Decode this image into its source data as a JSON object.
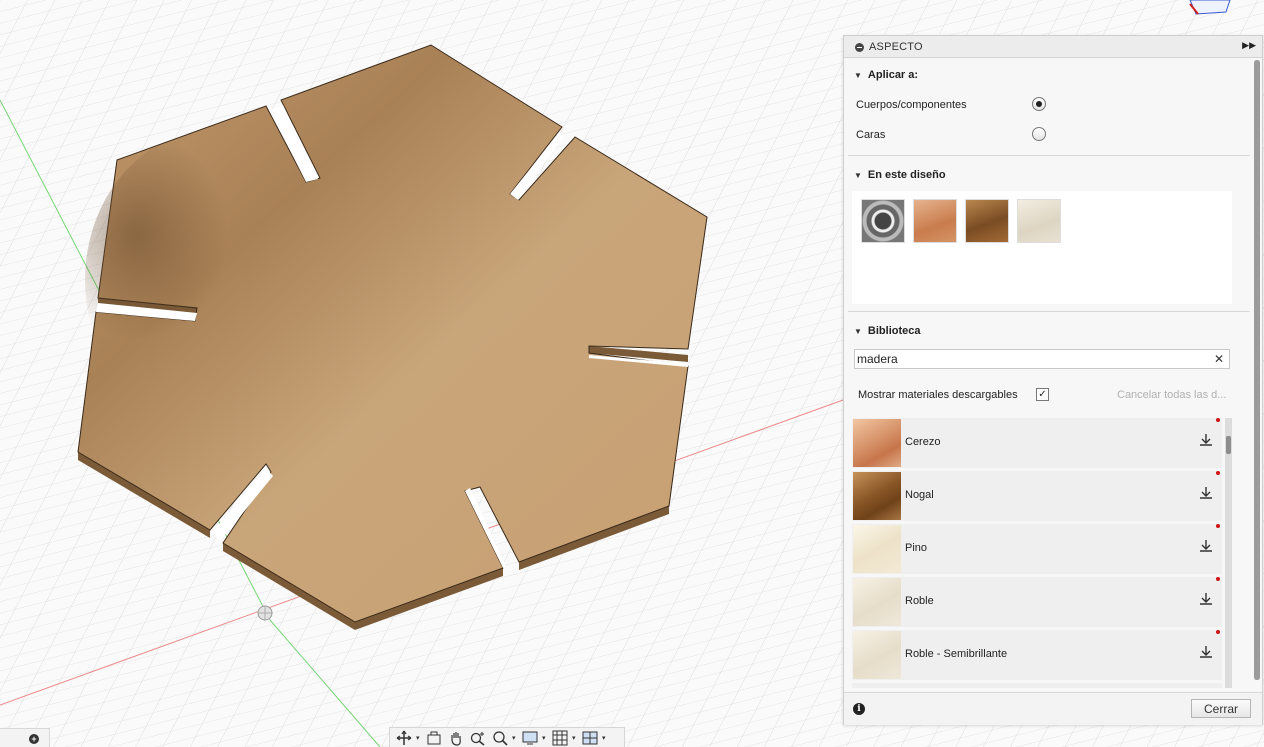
{
  "panel": {
    "title": "ASPECTO",
    "apply_to": {
      "title": "Aplicar a:",
      "options": [
        {
          "label": "Cuerpos/componentes",
          "selected": true
        },
        {
          "label": "Caras",
          "selected": false
        }
      ]
    },
    "in_design": {
      "title": "En este diseño",
      "swatches": [
        "chrome",
        "cherry",
        "walnut",
        "oak"
      ]
    },
    "library": {
      "title": "Biblioteca",
      "search_value": "madera",
      "show_downloadable_label": "Mostrar materiales descargables",
      "show_downloadable_checked": true,
      "cancel_all_label": "Cancelar todas las d...",
      "materials": [
        {
          "name": "Cerezo",
          "texture": "cherry"
        },
        {
          "name": "Nogal",
          "texture": "walnut"
        },
        {
          "name": "Pino",
          "texture": "pine"
        },
        {
          "name": "Roble",
          "texture": "oak"
        },
        {
          "name": "Roble - Semibrillante",
          "texture": "oak"
        }
      ]
    },
    "close_label": "Cerrar"
  },
  "colors": {
    "wood_top": "#c9a377",
    "wood_edge": "#7a5a3a",
    "grid": "#dcdcdc",
    "axis_green": "#6ed66e",
    "axis_red": "#e88080"
  },
  "toolbar_icons": [
    "orbit-icon",
    "look-at-icon",
    "pan-icon",
    "zoom-icon",
    "fit-icon",
    "display-settings-icon",
    "grid-settings-icon",
    "viewports-icon"
  ]
}
